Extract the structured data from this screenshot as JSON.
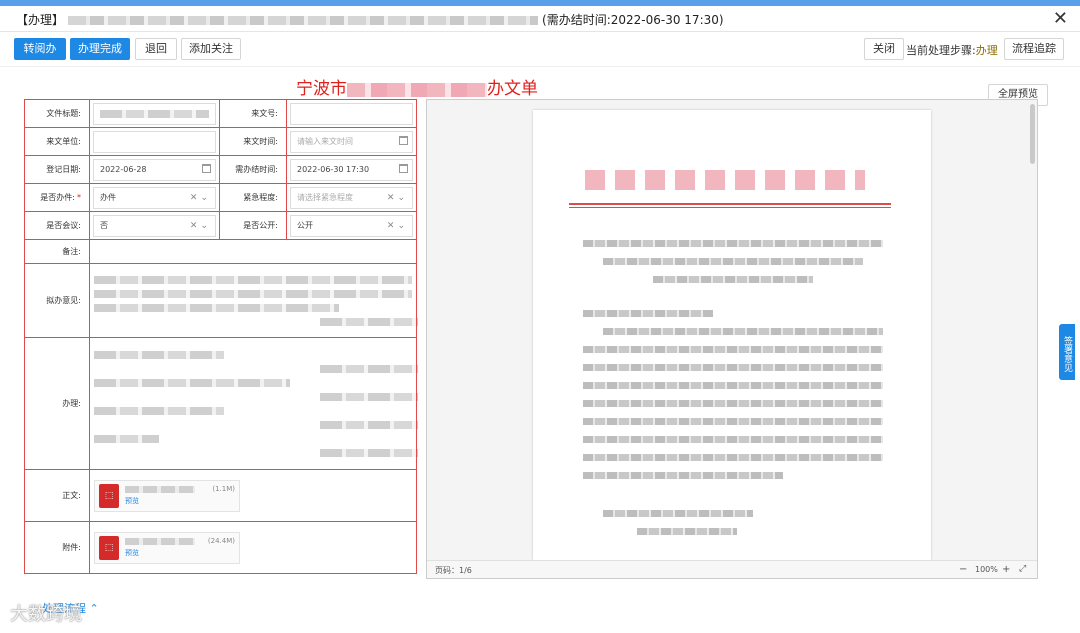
{
  "title": {
    "prefix": "【办理】",
    "suffix": "(需办结时间:2022-06-30 17:30)"
  },
  "toolbar": {
    "transfer": "转阅办",
    "complete": "办理完成",
    "return": "退回",
    "follow": "添加关注",
    "close": "关闭",
    "step_label": "当前处理步骤:",
    "step_value": "办理",
    "trace": "流程追踪"
  },
  "form": {
    "title_left": "宁波市",
    "title_right": "办文单",
    "preview_all": "全屏预览",
    "fields": {
      "doc_title": "文件标题:",
      "doc_no": "来文号:",
      "from_unit": "来文单位:",
      "from_time": "来文时间:",
      "from_time_placeholder": "请输入来文时间",
      "reg_date": "登记日期:",
      "reg_date_value": "2022-06-28",
      "deadline": "需办结时间:",
      "deadline_value": "2022-06-30 17:30",
      "is_doc": "是否办件:",
      "is_doc_value": "办件",
      "urgency": "紧急程度:",
      "urgency_placeholder": "请选择紧急程度",
      "is_meeting": "是否会议:",
      "is_meeting_value": "否",
      "is_public": "是否公开:",
      "is_public_value": "公开",
      "remark": "备注:",
      "opinion": "拟办意见:",
      "handling": "办理:",
      "main_text": "正文:",
      "attachment": "附件:"
    },
    "main_file": {
      "size": "(1.1M)",
      "preview": "预览",
      "icon": "pdf-icon"
    },
    "attach_file": {
      "size": "(24.4M)",
      "preview": "预览",
      "icon": "pdf-icon"
    }
  },
  "viewer": {
    "page_label": "页码：1/6",
    "zoom": "100%",
    "zoom_out": "−",
    "zoom_in": "+"
  },
  "side_tab": "签署意见",
  "flow": "处理流程 ⌃",
  "watermark": "大数跨境"
}
